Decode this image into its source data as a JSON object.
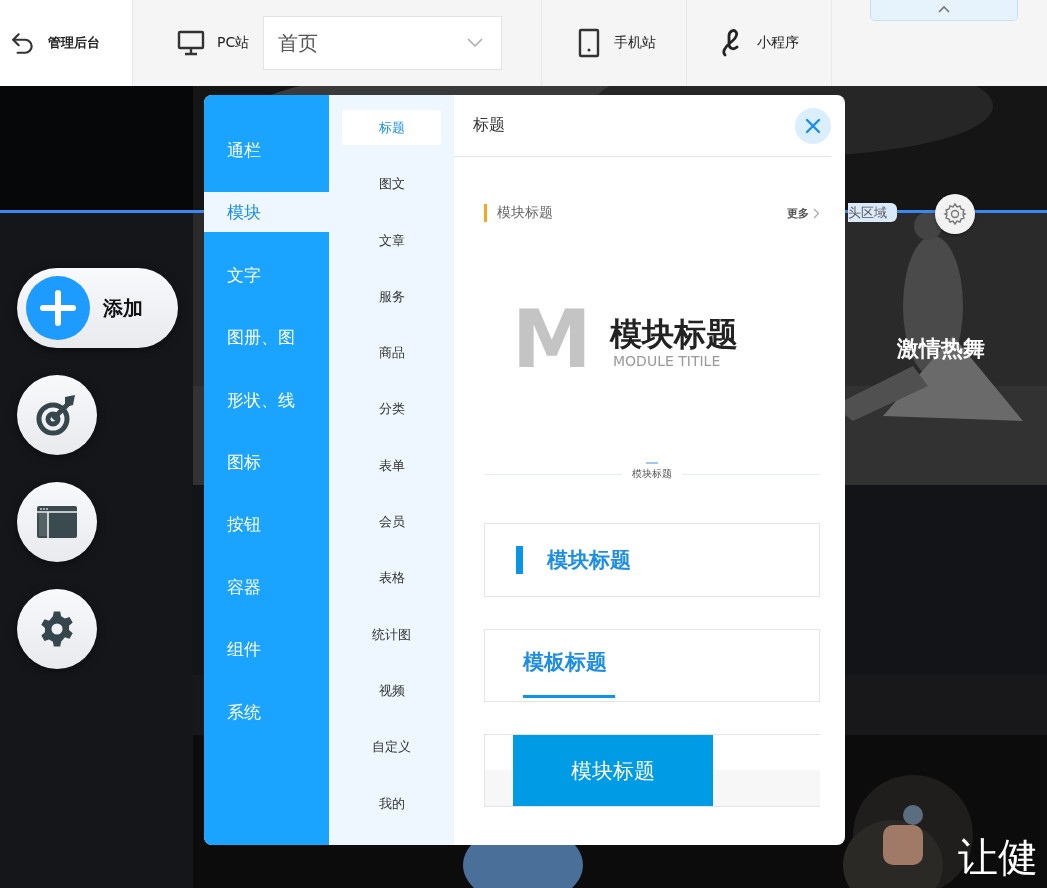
{
  "topbar": {
    "back_label": "管理后台",
    "pc_label": "PC站",
    "page_select": {
      "value": "首页"
    },
    "mobile_label": "手机站",
    "miniapp_label": "小程序"
  },
  "canvas": {
    "region_label": "头区域",
    "banner_1_text": "激情热舞",
    "banner_2_text": "让健"
  },
  "tools": [
    {
      "kind": "add",
      "label": "添加"
    },
    {
      "kind": "target"
    },
    {
      "kind": "layout"
    },
    {
      "kind": "settings"
    }
  ],
  "panel": {
    "categories": [
      {
        "label": "通栏",
        "selected": false
      },
      {
        "label": "模块",
        "selected": true
      },
      {
        "label": "文字",
        "selected": false
      },
      {
        "label": "图册、图",
        "selected": false
      },
      {
        "label": "形状、线",
        "selected": false
      },
      {
        "label": "图标",
        "selected": false
      },
      {
        "label": "按钮",
        "selected": false
      },
      {
        "label": "容器",
        "selected": false
      },
      {
        "label": "组件",
        "selected": false
      },
      {
        "label": "系统",
        "selected": false
      }
    ],
    "subcategories": [
      {
        "label": "标题",
        "selected": true
      },
      {
        "label": "图文",
        "selected": false
      },
      {
        "label": "文章",
        "selected": false
      },
      {
        "label": "服务",
        "selected": false
      },
      {
        "label": "商品",
        "selected": false
      },
      {
        "label": "分类",
        "selected": false
      },
      {
        "label": "表单",
        "selected": false
      },
      {
        "label": "会员",
        "selected": false
      },
      {
        "label": "表格",
        "selected": false
      },
      {
        "label": "统计图",
        "selected": false
      },
      {
        "label": "视频",
        "selected": false
      },
      {
        "label": "自定义",
        "selected": false
      },
      {
        "label": "我的",
        "selected": false
      }
    ],
    "title": "标题",
    "previews": [
      {
        "kind": "bar-more",
        "title": "模块标题",
        "more": "更多"
      },
      {
        "kind": "watermark",
        "watermark": "M",
        "title": "模块标题",
        "subtitle": "MODULE TITILE"
      },
      {
        "kind": "centered-line",
        "title": "模块标题"
      },
      {
        "kind": "left-bar",
        "title": "模块标题"
      },
      {
        "kind": "underline",
        "title": "模板标题"
      },
      {
        "kind": "block",
        "title": "模块标题"
      }
    ]
  }
}
